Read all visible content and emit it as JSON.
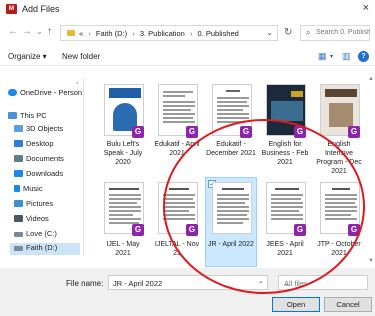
{
  "window": {
    "title": "Add Files",
    "app_badge": "M",
    "close": "×"
  },
  "nav": {
    "back": "←",
    "forward": "→",
    "up": "↑",
    "dropdown": "⌄",
    "refresh": "↻"
  },
  "address": {
    "breadcrumbs": [
      "«",
      "Faith (D:)",
      "3. Publication",
      "0. Published"
    ],
    "separator": "›",
    "chevron": "⌄"
  },
  "search": {
    "placeholder": "Search 0. Published"
  },
  "toolbar": {
    "organize": "Organize ▾",
    "new_folder": "New folder"
  },
  "sidebar": {
    "items": [
      {
        "label": "OneDrive - Person",
        "icon": "cloud-icon",
        "color": "#1e88e5"
      },
      {
        "label": "This PC",
        "icon": "pc-icon",
        "color": "#4a90d9"
      },
      {
        "label": "3D Objects",
        "icon": "cube-icon",
        "color": "#5aa0e0"
      },
      {
        "label": "Desktop",
        "icon": "desktop-icon",
        "color": "#2c7fd4"
      },
      {
        "label": "Documents",
        "icon": "documents-icon",
        "color": "#607d8b"
      },
      {
        "label": "Downloads",
        "icon": "downloads-icon",
        "color": "#1e88e5"
      },
      {
        "label": "Music",
        "icon": "music-icon",
        "color": "#1e88e5"
      },
      {
        "label": "Pictures",
        "icon": "pictures-icon",
        "color": "#3f8fd6"
      },
      {
        "label": "Videos",
        "icon": "videos-icon",
        "color": "#455a64"
      },
      {
        "label": "Love (C:)",
        "icon": "drive-icon",
        "color": "#7a8a99"
      },
      {
        "label": "Faith (D:)",
        "icon": "drive-icon",
        "color": "#7a8a99"
      }
    ]
  },
  "files": [
    {
      "name": "Bulu Left's Speak - July 2020",
      "kind": "cover-blue",
      "selected": false
    },
    {
      "name": "Edukatif - April 2021",
      "kind": "doc",
      "selected": false
    },
    {
      "name": "Edukatif - December 2021",
      "kind": "doc",
      "selected": false
    },
    {
      "name": "English for Business - Feb 2021",
      "kind": "cover-dark",
      "selected": false
    },
    {
      "name": "English Intensive Program - Dec 2021",
      "kind": "cover-light",
      "selected": false
    },
    {
      "name": "IJEL - May 2021",
      "kind": "doc",
      "selected": false
    },
    {
      "name": "IJELTAL - Nov 21",
      "kind": "doc",
      "selected": false
    },
    {
      "name": "JR - April 2022",
      "kind": "doc",
      "selected": true
    },
    {
      "name": "JEES - April 2021",
      "kind": "doc",
      "selected": false
    },
    {
      "name": "JTP - October 2021",
      "kind": "doc",
      "selected": false
    }
  ],
  "badge_letter": "G",
  "check_mark": "✓",
  "footer": {
    "file_name_label": "File name:",
    "file_name_value": "JR - April 2022",
    "file_type_value": "All files",
    "open_label": "Open",
    "cancel_label": "Cancel"
  },
  "colors": {
    "accent_circle": "#e0191f",
    "selection": "#cce8ff",
    "badge": "#8e24aa"
  }
}
